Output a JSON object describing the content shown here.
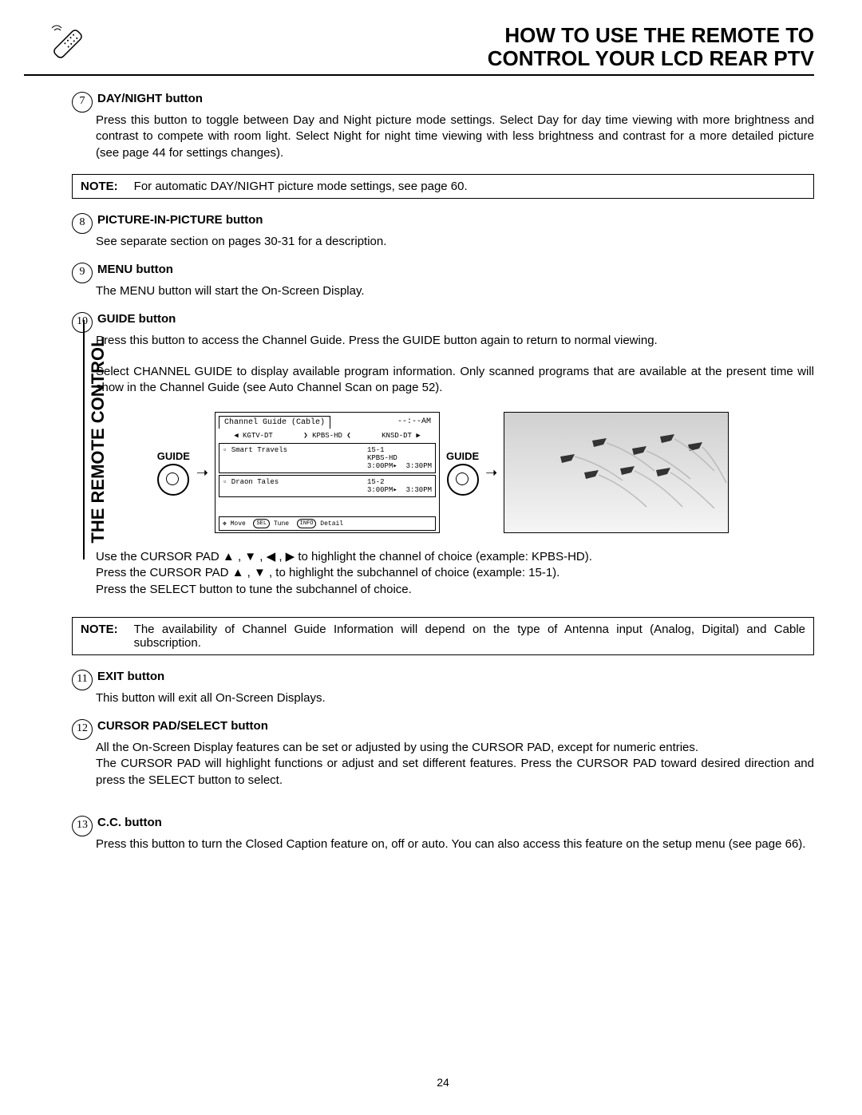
{
  "header": {
    "title_line1": "HOW TO USE THE REMOTE TO",
    "title_line2": "CONTROL YOUR LCD REAR PTV"
  },
  "side_label": "THE REMOTE CONTROL",
  "items": [
    {
      "num": "7",
      "title": "DAY/NIGHT button",
      "desc": "Press this button to toggle between Day and Night picture mode settings.  Select Day for day time viewing with more brightness and contrast to compete with room light.  Select Night for night time viewing with less brightness and contrast for a more detailed picture (see page 44 for settings changes)."
    },
    {
      "num": "8",
      "title": "PICTURE-IN-PICTURE button",
      "desc": "See separate section on pages 30-31 for a description."
    },
    {
      "num": "9",
      "title": "MENU button",
      "desc": "The MENU button will start the On-Screen Display."
    },
    {
      "num": "10",
      "title": "GUIDE button",
      "desc": "Press this button to access the Channel Guide.  Press the GUIDE button again to return to normal viewing.",
      "desc2": "Select CHANNEL GUIDE to display available program information.  Only scanned programs that are available at the present time will show in the Channel Guide (see Auto Channel Scan on page 52)."
    },
    {
      "num": "11",
      "title": "EXIT button",
      "desc": "This button will exit all On-Screen Displays."
    },
    {
      "num": "12",
      "title": "CURSOR PAD/SELECT button",
      "desc": "All the On-Screen Display features can be set or adjusted by using the CURSOR PAD, except for numeric entries.\nThe CURSOR PAD will highlight functions or adjust and set different features.  Press the CURSOR PAD toward desired direction and press the SELECT button to select."
    },
    {
      "num": "13",
      "title": "C.C. button",
      "desc": "Press this button to turn the Closed Caption feature on, off or auto.  You can also access this feature on the setup menu (see page 66)."
    }
  ],
  "notes": {
    "label": "NOTE:",
    "note1": "For automatic DAY/NIGHT picture mode settings, see page 60.",
    "note2": "The availability of Channel Guide Information will depend on the type of Antenna input (Analog, Digital) and Cable subscription."
  },
  "guide": {
    "label": "GUIDE",
    "osd_title": "Channel Guide (Cable)",
    "osd_time": "--:--AM",
    "channels": [
      "◀ KGTV-DT",
      "❯ KPBS-HD ❮",
      "KNSD-DT ▶"
    ],
    "prog1": {
      "name": "▫ Smart Travels",
      "ch": "15-1",
      "src": "KPBS-HD",
      "t1": "3:00PM▸",
      "t2": "3:30PM"
    },
    "prog2": {
      "name": "▫ Draon Tales",
      "ch": "15-2",
      "t1": "3:00PM▸",
      "t2": "3:30PM"
    },
    "footer_move": "✥ Move",
    "footer_sel": "SEL",
    "footer_tune": "Tune",
    "footer_info": "INFO",
    "footer_detail": "Detail"
  },
  "cursor": {
    "line1_a": "Use the CURSOR PAD ▲ , ▼ , ◀ , ▶ to highlight the channel of choice (example: KPBS-HD).",
    "line2_a": "Press  the CURSOR PAD ▲ , ▼ , to highlight the subchannel of choice (example: 15-1).",
    "line3": "Press the SELECT button to tune the subchannel of choice."
  },
  "page_number": "24"
}
